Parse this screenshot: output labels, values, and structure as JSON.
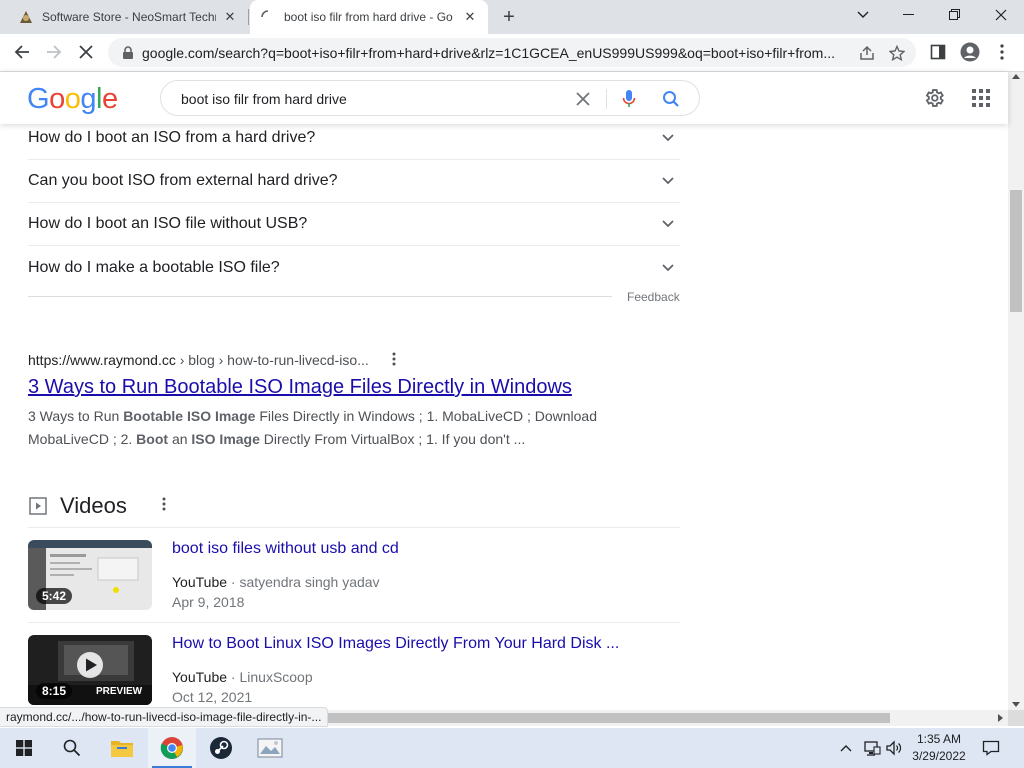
{
  "browser": {
    "tabs": [
      {
        "title": "Software Store - NeoSmart Techn",
        "icon": "neosmart-favicon"
      },
      {
        "title": "boot iso filr from hard drive - Go",
        "icon": "loading-spinner-icon"
      }
    ],
    "url": "google.com/search?q=boot+iso+filr+from+hard+drive&rlz=1C1GCEA_enUS999US999&oq=boot+iso+filr+from..."
  },
  "google": {
    "logo_letters": [
      {
        "ch": "G",
        "color": "#4285f4"
      },
      {
        "ch": "o",
        "color": "#ea4335"
      },
      {
        "ch": "o",
        "color": "#fbbc05"
      },
      {
        "ch": "g",
        "color": "#4285f4"
      },
      {
        "ch": "l",
        "color": "#34a853"
      },
      {
        "ch": "e",
        "color": "#ea4335"
      }
    ],
    "query": "boot iso filr from hard drive"
  },
  "paa": [
    "How do I boot an ISO from a hard drive?",
    "Can you boot ISO from external hard drive?",
    "How do I boot an ISO file without USB?",
    "How do I make a bootable ISO file?"
  ],
  "feedback": "Feedback",
  "result": {
    "domain": "https://www.raymond.cc",
    "breadcrumb": " › blog › how-to-run-livecd-iso...",
    "title": "3 Ways to Run Bootable ISO Image Files Directly in Windows",
    "snippet_parts": [
      {
        "t": "3 Ways to Run ",
        "b": false
      },
      {
        "t": "Bootable ISO Image",
        "b": true
      },
      {
        "t": " Files Directly in Windows ; 1. MobaLiveCD ; Download MobaLiveCD ; 2. ",
        "b": false
      },
      {
        "t": "Boot",
        "b": true
      },
      {
        "t": " an ",
        "b": false
      },
      {
        "t": "ISO Image",
        "b": true
      },
      {
        "t": " Directly From VirtualBox ; 1. If you don't ...",
        "b": false
      }
    ]
  },
  "videos": {
    "heading": "Videos",
    "items": [
      {
        "title": "boot iso files without usb and cd",
        "source": "YouTube",
        "channel": "satyendra singh yadav",
        "date": "Apr 9, 2018",
        "duration": "5:42"
      },
      {
        "title": "How to Boot Linux ISO Images Directly From Your Hard Disk ...",
        "source": "YouTube",
        "channel": "LinuxScoop",
        "date": "Oct 12, 2021",
        "duration": "8:15",
        "overlay": "PREVIEW"
      }
    ]
  },
  "status_url": "raymond.cc/.../how-to-run-livecd-iso-image-file-directly-in-...",
  "taskbar": {
    "time": "1:35 AM",
    "date": "3/29/2022"
  },
  "colors": {
    "link": "#1a0dab",
    "google_blue": "#4285f4",
    "google_red": "#ea4335",
    "taskbar_bg": "#dde6f2"
  }
}
